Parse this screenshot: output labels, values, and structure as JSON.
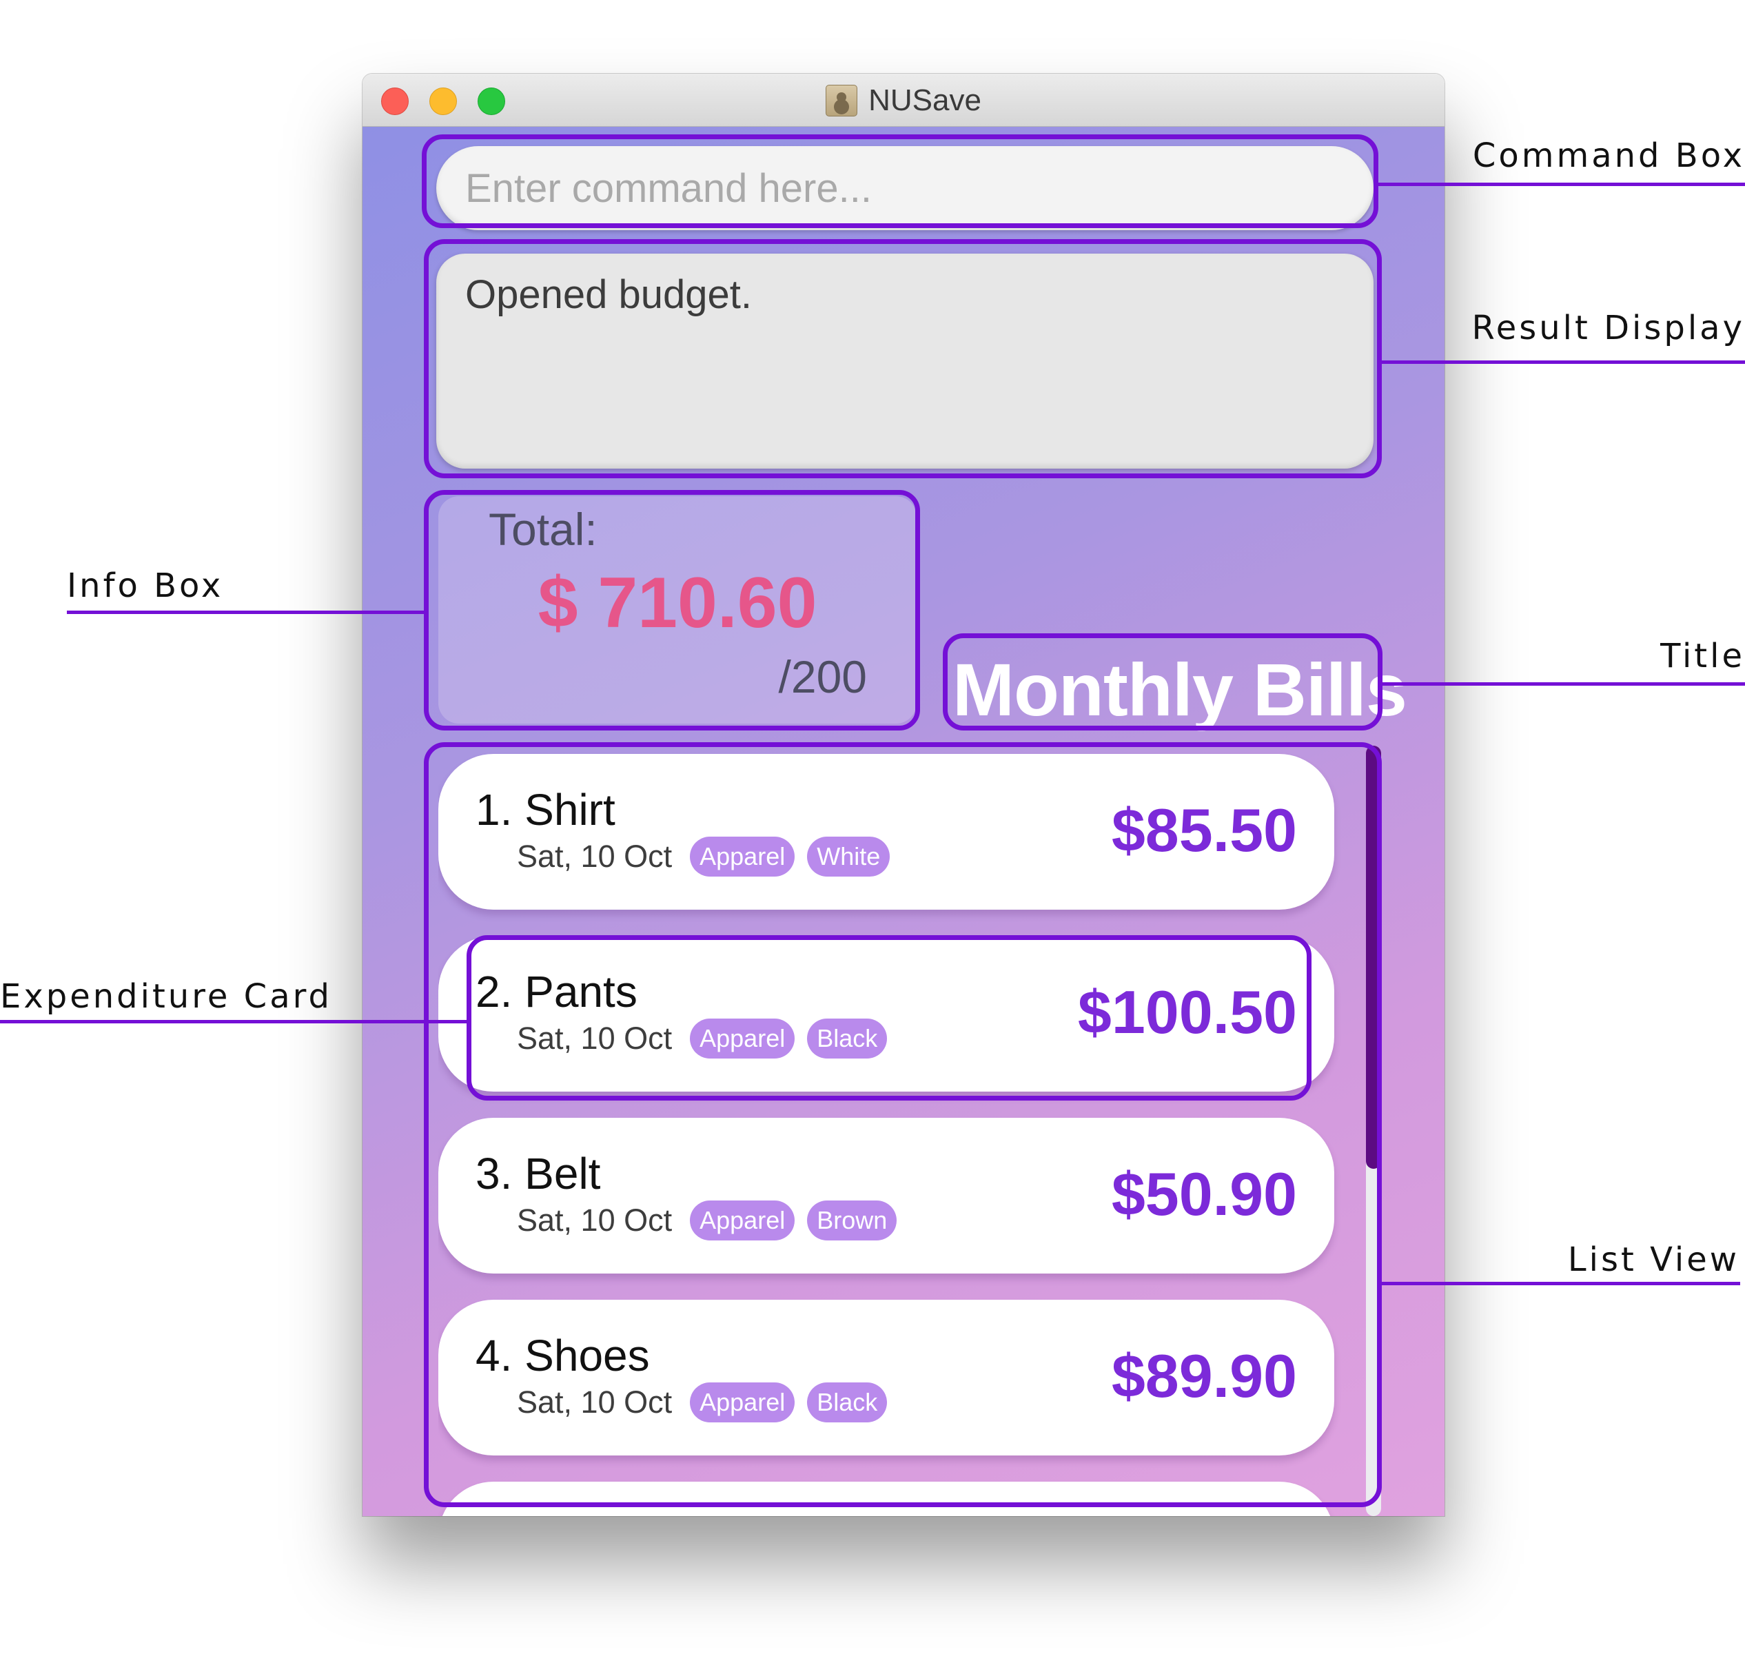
{
  "window": {
    "title": "NUSave"
  },
  "command_box": {
    "placeholder": "Enter command here..."
  },
  "result_display": {
    "text": "Opened budget."
  },
  "info_box": {
    "label": "Total:",
    "amount": "$ 710.60",
    "limit": "/200"
  },
  "page_title": "Monthly Bills",
  "expenditures": [
    {
      "title": "1. Shirt",
      "date": "Sat, 10 Oct",
      "tags": [
        "Apparel",
        "White"
      ],
      "price": "$85.50"
    },
    {
      "title": "2. Pants",
      "date": "Sat, 10 Oct",
      "tags": [
        "Apparel",
        "Black"
      ],
      "price": "$100.50"
    },
    {
      "title": "3. Belt",
      "date": "Sat, 10 Oct",
      "tags": [
        "Apparel",
        "Brown"
      ],
      "price": "$50.90"
    },
    {
      "title": "4. Shoes",
      "date": "Sat, 10 Oct",
      "tags": [
        "Apparel",
        "Black"
      ],
      "price": "$89.90"
    },
    {
      "title": "",
      "date": "",
      "tags": [],
      "price": ""
    }
  ],
  "annotations": {
    "command_box": "Command Box",
    "result_display": "Result Display",
    "info_box": "Info Box",
    "title": "Title",
    "expenditure_card": "Expenditure Card",
    "list_view": "List View"
  },
  "colors": {
    "annotation": "#7410d6",
    "price": "#7c2ad9",
    "total": "#e6568a",
    "tag": "#b98aec",
    "scroll_thumb": "#5c0b82"
  }
}
